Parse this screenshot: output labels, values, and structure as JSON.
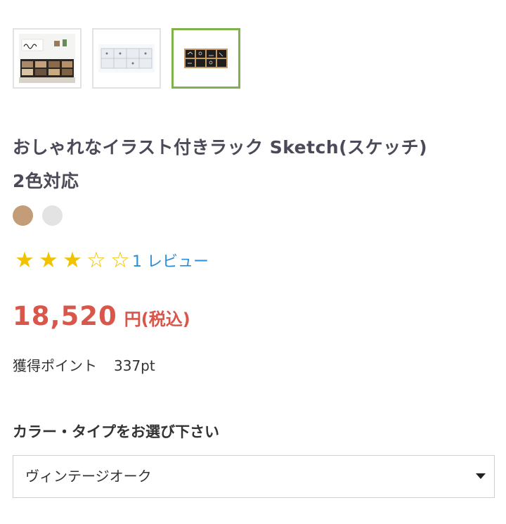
{
  "thumbnails": [
    {
      "icon": "shelf-with-sketch-sign-photo",
      "active": false
    },
    {
      "icon": "white-shelf-photo",
      "active": false
    },
    {
      "icon": "black-shelf-photo",
      "active": true
    }
  ],
  "product": {
    "title_line1": "おしゃれなイラスト付きラック Sketch(スケッチ)",
    "title_line2": "2色対応"
  },
  "swatches": [
    {
      "name": "vintage-oak",
      "color": "#c29d77"
    },
    {
      "name": "white",
      "color": "#e3e3e3"
    }
  ],
  "rating": {
    "value": 3,
    "max": 5,
    "full_star": "★",
    "empty_star": "☆",
    "review_link": "1 レビュー"
  },
  "price": {
    "amount": "18,520",
    "unit": "円(税込)"
  },
  "points": {
    "label": "獲得ポイント",
    "value": "337pt"
  },
  "option": {
    "label": "カラー・タイプをお選び下さい",
    "selected": "ヴィンテージオーク"
  },
  "colors": {
    "accent_green": "#7fb24a",
    "price_red": "#d9564a",
    "link_blue": "#2b8fd6",
    "star_yellow": "#f2c200"
  }
}
